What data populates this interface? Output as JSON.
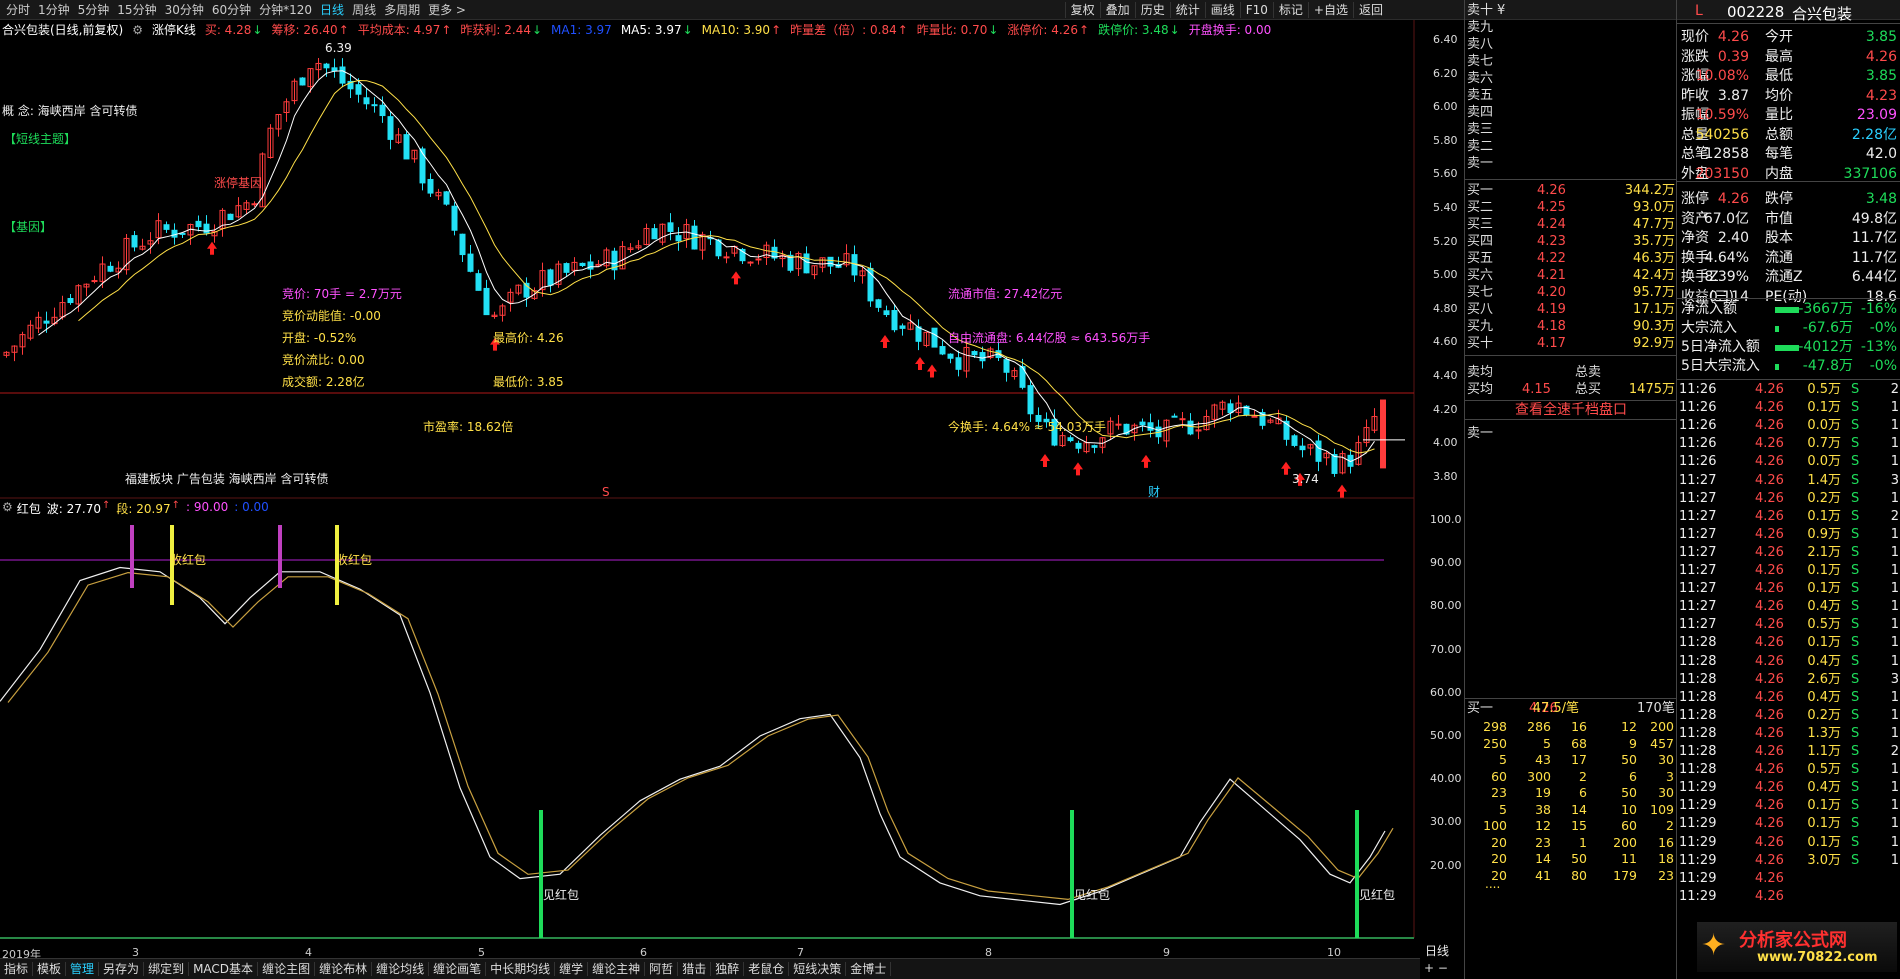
{
  "top_toolbar": {
    "timeframes": [
      "分时",
      "1分钟",
      "5分钟",
      "15分钟",
      "30分钟",
      "60分钟",
      "分钟*120",
      "日线",
      "周线",
      "多周期",
      "更多 >"
    ],
    "active": "日线",
    "right_buttons": [
      "复权",
      "叠加",
      "历史",
      "统计",
      "画线",
      "F10",
      "标记",
      "+自选",
      "返回"
    ]
  },
  "chart_header": {
    "title": "合兴包装(日线,前复权)",
    "indicator": "涨停K线",
    "items": [
      {
        "text": "买: 4.28",
        "color": "#ff4b4b",
        "arrow": "down"
      },
      {
        "text": "筹移: 26.40",
        "color": "#ff4b4b",
        "arrow": "up"
      },
      {
        "text": "平均成本: 4.97",
        "color": "#ff4b4b",
        "arrow": "up"
      },
      {
        "text": "昨获利: 2.44",
        "color": "#ff4b4b",
        "arrow": "down"
      },
      {
        "text": "MA1: 3.97",
        "color": "#2050ff",
        "arrow": ""
      },
      {
        "text": "MA5: 3.97",
        "color": "#ffffff",
        "arrow": "down"
      },
      {
        "text": "MA10: 3.90",
        "color": "#ffe048",
        "arrow": "up"
      },
      {
        "text": "昨量差（倍）: 0.84",
        "color": "#ff4b4b",
        "arrow": "up"
      },
      {
        "text": "昨量比: 0.70",
        "color": "#ff4b4b",
        "arrow": "down"
      },
      {
        "text": "涨停价: 4.26",
        "color": "#ff4b4b",
        "arrow": "up"
      },
      {
        "text": "跌停价: 3.48",
        "color": "#1edc5a",
        "arrow": "down"
      },
      {
        "text": "开盘换手: 0.00",
        "color": "#ff52ff",
        "arrow": ""
      }
    ]
  },
  "left_labels": {
    "concept": "概 念: 海峡西岸 含可转债",
    "short_theme": "【短线主题】",
    "gene": "【基因】",
    "block": "福建板块 广告包装 海峡西岸 含可转债"
  },
  "chart_annotations": {
    "high": "6.39",
    "low": "3.74",
    "bid_price": "竞价: 70手 = 2.7万元",
    "bid_momentum": "竞价动能值: -0.00",
    "open": "开盘: -0.52%",
    "bid_flow": "竞价流比: 0.00",
    "turnover_amt": "成交额: 2.28亿",
    "day_high": "最高价: 4.26",
    "day_low": "最低价: 3.85",
    "float_mv": "流通市值: 27.42亿元",
    "free_float": "自由流通盘: 6.44亿股 ≈ 643.56万手",
    "today_turn": "今换手: 4.64% ≈ 54.03万手",
    "pe": "市盈率: 18.62倍",
    "s_marker": "S",
    "cai_marker": "财",
    "limit_tag": "涨停基因"
  },
  "price_axis": [
    "6.40",
    "6.20",
    "6.00",
    "5.80",
    "5.60",
    "5.40",
    "5.20",
    "5.00",
    "4.80",
    "4.60",
    "4.40",
    "4.20",
    "4.00",
    "3.80"
  ],
  "indicator": {
    "name": "红包",
    "header": [
      {
        "text": "红包",
        "color": "#ffffff"
      },
      {
        "text": "波: 27.70",
        "color": "#ffffff",
        "arrow": "up"
      },
      {
        "text": "段: 20.97",
        "color": "#ffe048",
        "arrow": "up"
      },
      {
        "text": ": 90.00",
        "color": "#ff52ff"
      },
      {
        "text": ": 0.00",
        "color": "#2050ff"
      }
    ],
    "axis": [
      "100.0",
      "90.00",
      "80.00",
      "70.00",
      "60.00",
      "50.00",
      "40.00",
      "30.00",
      "20.00"
    ],
    "take_label": "收红包",
    "see_label": "见红包"
  },
  "x_axis": [
    "2019年",
    "3",
    "4",
    "5",
    "6",
    "7",
    "8",
    "9",
    "10"
  ],
  "x_axis_right": "日线",
  "bottom_tabs": [
    "指标",
    "模板",
    "管理",
    "另存为",
    "绑定到",
    "MACD基本",
    "缠论主图",
    "缠论布林",
    "缠论均线",
    "缠论画笔",
    "中长期均线",
    "缠学",
    "缠论主神",
    "阿哲",
    "猎击",
    "独醉",
    "老鼠仓",
    "短线决策",
    "金博士"
  ],
  "bottom_active": "管理",
  "orderbook": {
    "sells": [
      "卖十",
      "卖九",
      "卖八",
      "卖七",
      "卖六",
      "卖五",
      "卖四",
      "卖三",
      "卖二",
      "卖一"
    ],
    "sell_ten_mark": "¥",
    "buys": [
      {
        "label": "买一",
        "price": "4.26",
        "vol": "344.2万"
      },
      {
        "label": "买二",
        "price": "4.25",
        "vol": "93.0万"
      },
      {
        "label": "买三",
        "price": "4.24",
        "vol": "47.7万"
      },
      {
        "label": "买四",
        "price": "4.23",
        "vol": "35.7万"
      },
      {
        "label": "买五",
        "price": "4.22",
        "vol": "46.3万"
      },
      {
        "label": "买六",
        "price": "4.21",
        "vol": "42.4万"
      },
      {
        "label": "买七",
        "price": "4.20",
        "vol": "95.7万"
      },
      {
        "label": "买八",
        "price": "4.19",
        "vol": "17.1万"
      },
      {
        "label": "买九",
        "price": "4.18",
        "vol": "90.3万"
      },
      {
        "label": "买十",
        "price": "4.17",
        "vol": "92.9万"
      }
    ],
    "sell_avg": "卖均",
    "buy_avg": "买均",
    "buy_avg_price": "4.15",
    "total_sell": "总卖",
    "total_buy": "总买",
    "total_buy_vol": "1475万",
    "full_depth_link": "查看全速千档盘口",
    "sell_one_bottom": "卖一",
    "buy_one_summary": {
      "label": "买一",
      "price": "4.26",
      "per": "47.5/笔",
      "count": "170笔"
    },
    "depth_rows": [
      [
        "298",
        "286",
        "16",
        "12",
        "200"
      ],
      [
        "250",
        "5",
        "68",
        "9",
        "457"
      ],
      [
        "5",
        "43",
        "17",
        "50",
        "30"
      ],
      [
        "60",
        "300",
        "2",
        "6",
        "3"
      ],
      [
        "23",
        "19",
        "6",
        "50",
        "30"
      ],
      [
        "5",
        "38",
        "14",
        "10",
        "109"
      ],
      [
        "100",
        "12",
        "15",
        "60",
        "2"
      ],
      [
        "20",
        "23",
        "1",
        "200",
        "16"
      ],
      [
        "20",
        "14",
        "50",
        "11",
        "18"
      ],
      [
        "20",
        "41",
        "80",
        "179",
        "23"
      ]
    ],
    "more": "...."
  },
  "info": {
    "flag": "L",
    "code": "002228",
    "name": "合兴包装",
    "rows": [
      [
        {
          "t": "现价",
          "c": "wht"
        },
        {
          "t": "4.26",
          "c": "red"
        },
        {
          "t": "今开",
          "c": "wht"
        },
        {
          "t": "3.85",
          "c": "grn"
        }
      ],
      [
        {
          "t": "涨跌",
          "c": "wht"
        },
        {
          "t": "0.39",
          "c": "red"
        },
        {
          "t": "最高",
          "c": "wht"
        },
        {
          "t": "4.26",
          "c": "red"
        }
      ],
      [
        {
          "t": "涨幅",
          "c": "wht"
        },
        {
          "t": "10.08%",
          "c": "red"
        },
        {
          "t": "最低",
          "c": "wht"
        },
        {
          "t": "3.85",
          "c": "grn"
        }
      ],
      [
        {
          "t": "昨收",
          "c": "wht"
        },
        {
          "t": "3.87",
          "c": "wht"
        },
        {
          "t": "均价",
          "c": "wht"
        },
        {
          "t": "4.23",
          "c": "red"
        }
      ],
      [
        {
          "t": "振幅",
          "c": "wht"
        },
        {
          "t": "10.59%",
          "c": "red"
        },
        {
          "t": "量比",
          "c": "wht"
        },
        {
          "t": "23.09",
          "c": "mag"
        }
      ],
      [
        {
          "t": "总量",
          "c": "wht"
        },
        {
          "t": "540256",
          "c": "yel"
        },
        {
          "t": "总额",
          "c": "wht"
        },
        {
          "t": "2.28亿",
          "c": "cyn"
        }
      ],
      [
        {
          "t": "总笔",
          "c": "wht"
        },
        {
          "t": "12858",
          "c": "wht"
        },
        {
          "t": "每笔",
          "c": "wht"
        },
        {
          "t": "42.0",
          "c": "wht"
        }
      ],
      [
        {
          "t": "外盘",
          "c": "wht"
        },
        {
          "t": "203150",
          "c": "red"
        },
        {
          "t": "内盘",
          "c": "wht"
        },
        {
          "t": "337106",
          "c": "grn"
        }
      ],
      [
        {
          "t": "涨停",
          "c": "wht"
        },
        {
          "t": "4.26",
          "c": "red"
        },
        {
          "t": "跌停",
          "c": "wht"
        },
        {
          "t": "3.48",
          "c": "grn"
        }
      ],
      [
        {
          "t": "资产",
          "c": "wht"
        },
        {
          "t": "67.0亿",
          "c": "wht"
        },
        {
          "t": "市值",
          "c": "wht"
        },
        {
          "t": "49.8亿",
          "c": "wht"
        }
      ],
      [
        {
          "t": "净资",
          "c": "wht"
        },
        {
          "t": "2.40",
          "c": "wht"
        },
        {
          "t": "股本",
          "c": "wht"
        },
        {
          "t": "11.7亿",
          "c": "wht"
        }
      ],
      [
        {
          "t": "换手",
          "c": "wht"
        },
        {
          "t": "4.64%",
          "c": "wht"
        },
        {
          "t": "流通",
          "c": "wht"
        },
        {
          "t": "11.7亿",
          "c": "wht"
        }
      ],
      [
        {
          "t": "换手Z",
          "c": "wht"
        },
        {
          "t": "8.39%",
          "c": "wht"
        },
        {
          "t": "流通Z",
          "c": "wht"
        },
        {
          "t": "6.44亿",
          "c": "wht"
        }
      ],
      [
        {
          "t": "收益(三)",
          "c": "wht"
        },
        {
          "t": "0.114",
          "c": "wht"
        },
        {
          "t": "PE(动)",
          "c": "wht"
        },
        {
          "t": "18.6",
          "c": "wht"
        }
      ]
    ],
    "flows": [
      {
        "label": "净流入额",
        "value": "-3667万",
        "pct": "-16%"
      },
      {
        "label": "大宗流入",
        "value": "-67.6万",
        "pct": "-0%"
      },
      {
        "label": "5日净流入额",
        "value": "-4012万",
        "pct": "-13%"
      },
      {
        "label": "5日大宗流入",
        "value": "-47.8万",
        "pct": "-0%"
      }
    ],
    "ticks": [
      [
        "11:26",
        "4.26",
        "0.5万",
        "S",
        "2"
      ],
      [
        "11:26",
        "4.26",
        "0.1万",
        "S",
        "1"
      ],
      [
        "11:26",
        "4.26",
        "0.0万",
        "S",
        "1"
      ],
      [
        "11:26",
        "4.26",
        "0.7万",
        "S",
        "1"
      ],
      [
        "11:26",
        "4.26",
        "0.0万",
        "S",
        "1"
      ],
      [
        "11:27",
        "4.26",
        "1.4万",
        "S",
        "3"
      ],
      [
        "11:27",
        "4.26",
        "0.2万",
        "S",
        "1"
      ],
      [
        "11:27",
        "4.26",
        "0.1万",
        "S",
        "2"
      ],
      [
        "11:27",
        "4.26",
        "0.9万",
        "S",
        "1"
      ],
      [
        "11:27",
        "4.26",
        "2.1万",
        "S",
        "1"
      ],
      [
        "11:27",
        "4.26",
        "0.1万",
        "S",
        "1"
      ],
      [
        "11:27",
        "4.26",
        "0.1万",
        "S",
        "1"
      ],
      [
        "11:27",
        "4.26",
        "0.4万",
        "S",
        "1"
      ],
      [
        "11:27",
        "4.26",
        "0.5万",
        "S",
        "1"
      ],
      [
        "11:28",
        "4.26",
        "0.1万",
        "S",
        "1"
      ],
      [
        "11:28",
        "4.26",
        "0.4万",
        "S",
        "1"
      ],
      [
        "11:28",
        "4.26",
        "2.6万",
        "S",
        "3"
      ],
      [
        "11:28",
        "4.26",
        "0.4万",
        "S",
        "1"
      ],
      [
        "11:28",
        "4.26",
        "0.2万",
        "S",
        "1"
      ],
      [
        "11:28",
        "4.26",
        "1.3万",
        "S",
        "1"
      ],
      [
        "11:28",
        "4.26",
        "1.1万",
        "S",
        "2"
      ],
      [
        "11:28",
        "4.26",
        "0.5万",
        "S",
        "1"
      ],
      [
        "11:29",
        "4.26",
        "0.4万",
        "S",
        "1"
      ],
      [
        "11:29",
        "4.26",
        "0.1万",
        "S",
        "1"
      ],
      [
        "11:29",
        "4.26",
        "0.1万",
        "S",
        "1"
      ],
      [
        "11:29",
        "4.26",
        "0.1万",
        "S",
        "1"
      ],
      [
        "11:29",
        "4.26",
        "3.0万",
        "S",
        "1"
      ],
      [
        "11:29",
        "4.26",
        "",
        "",
        ""
      ],
      [
        "11:29",
        "4.26",
        "",
        "",
        ""
      ]
    ],
    "watermark": "分析家公式网",
    "watermark_url": "www.70822.com"
  },
  "colors": {
    "up": "#ff3c3c",
    "down": "#22e0f5",
    "ma5": "#ffffff",
    "ma10": "#ffe048",
    "threshold": "#b020d0"
  }
}
